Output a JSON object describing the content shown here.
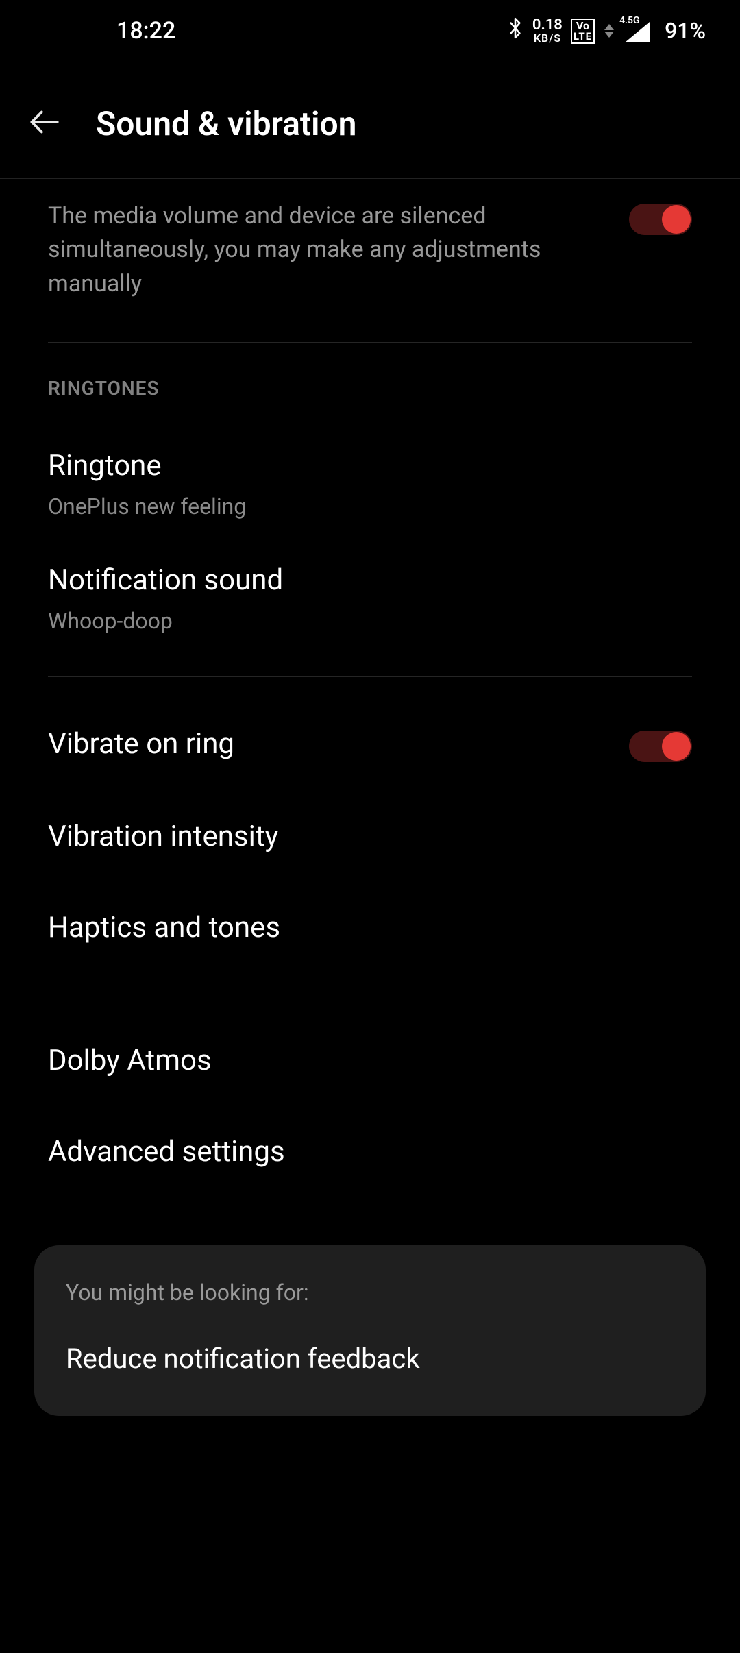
{
  "status_bar": {
    "time": "18:22",
    "data_rate": "0.18",
    "data_unit": "KB/S",
    "volte_top": "Vo",
    "volte_bottom": "LTE",
    "network_gen": "4.5G",
    "battery": "91%"
  },
  "header": {
    "title": "Sound & vibration"
  },
  "mute_media": {
    "description": "The media volume and device are silenced simultaneously, you may make any adjustments manually",
    "enabled": true
  },
  "sections": {
    "ringtones_header": "RINGTONES",
    "ringtone": {
      "title": "Ringtone",
      "value": "OnePlus new feeling"
    },
    "notification_sound": {
      "title": "Notification sound",
      "value": "Whoop-doop"
    },
    "vibrate_on_ring": {
      "title": "Vibrate on ring",
      "enabled": true
    },
    "vibration_intensity": {
      "title": "Vibration intensity"
    },
    "haptics_tones": {
      "title": "Haptics and tones"
    },
    "dolby_atmos": {
      "title": "Dolby Atmos"
    },
    "advanced": {
      "title": "Advanced settings"
    }
  },
  "suggestion": {
    "hint": "You might be looking for:",
    "item": "Reduce notification feedback"
  }
}
